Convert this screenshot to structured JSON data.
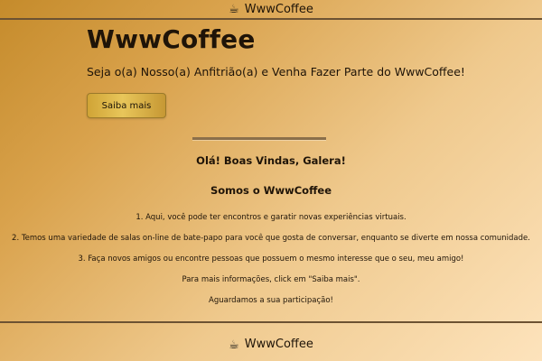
{
  "header": {
    "icon": "coffee-cup-icon",
    "brand": "WwwCoffee"
  },
  "hero": {
    "title": "WwwCoffee",
    "subtitle": "Seja o(a) Nosso(a) Anfitrião(a) e Venha Fazer Parte do WwwCoffee!",
    "button_label": "Saiba mais"
  },
  "content": {
    "welcome": "Olá! Boas Vindas, Galera!",
    "section_title": "Somos o WwwCoffee",
    "lines": [
      "1. Aqui, você pode ter encontros e garatir novas experiências virtuais.",
      "2. Temos uma variedade de salas on-line de bate-papo para você que gosta de conversar, enquanto se diverte em nossa comunidade.",
      "3. Faça novos amigos ou encontre pessoas que possuem o mesmo interesse que o seu, meu amigo!",
      "Para mais informações, click em \"Saiba mais\".",
      "Aguardamos a sua participação!"
    ]
  },
  "footer": {
    "icon": "coffee-cup-icon",
    "brand": "WwwCoffee"
  },
  "colors": {
    "background_start": "#c58b2b",
    "background_end": "#fde3bc",
    "button": "#d0a436",
    "text": "#1f1408",
    "rule": "#6c5232"
  }
}
